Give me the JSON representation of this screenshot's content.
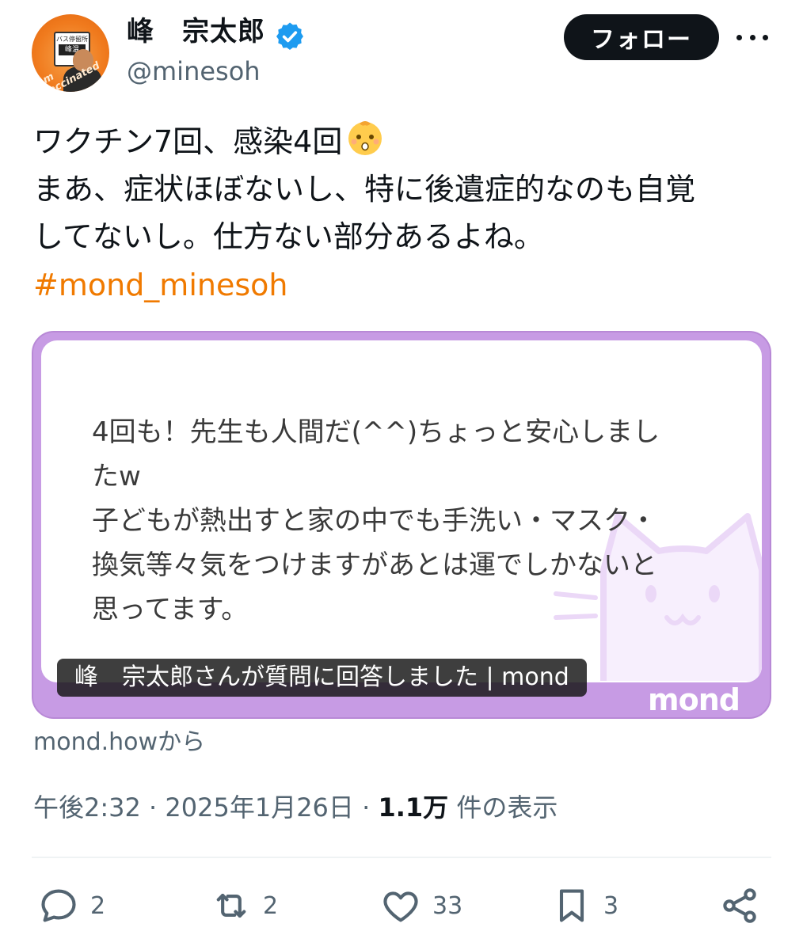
{
  "user": {
    "name": "峰　宗太郎",
    "handle": "@minesoh",
    "avatar_sign_top": "バス停留所",
    "avatar_sign_name": "峰温",
    "avatar_badge_text": "I'm Vaccinated"
  },
  "header": {
    "follow_label": "フォロー"
  },
  "tweet": {
    "line1": "ワクチン7回、感染4回",
    "line2": "まあ、症状ほぼないし、特に後遺症的なのも自覚",
    "line3": "してないし。仕方ない部分あるよね。",
    "hashtag": "#mond_minesoh"
  },
  "card": {
    "line1": "4回も！先生も人間だ(^^)ちょっと安心しまし",
    "line2": "たw",
    "line3": "子どもが熱出すと家の中でも手洗い・マスク・",
    "line4": "換気等々気をつけますがあとは運でしかないと",
    "line5": "思ってます。",
    "caption": "峰　宗太郎さんが質問に回答しました | mond",
    "logo": "mond"
  },
  "source": "mond.howから",
  "meta": {
    "time": "午後2:32",
    "sep1": " · ",
    "date": "2025年1月26日",
    "sep2": " · ",
    "views": "1.1万",
    "views_suffix": " 件の表示"
  },
  "actions": {
    "replies": "2",
    "reposts": "2",
    "likes": "33",
    "bookmarks": "3"
  },
  "colors": {
    "hashtag": "#f07a00",
    "verified": "#1d9bf0",
    "card_border": "#c79be4",
    "follow_bg": "#0f1419"
  },
  "icons": [
    "verified-badge-icon",
    "more-icon",
    "baby-emoji-icon",
    "cat-watermark-icon",
    "reply-icon",
    "repost-icon",
    "like-icon",
    "bookmark-icon",
    "share-icon"
  ]
}
